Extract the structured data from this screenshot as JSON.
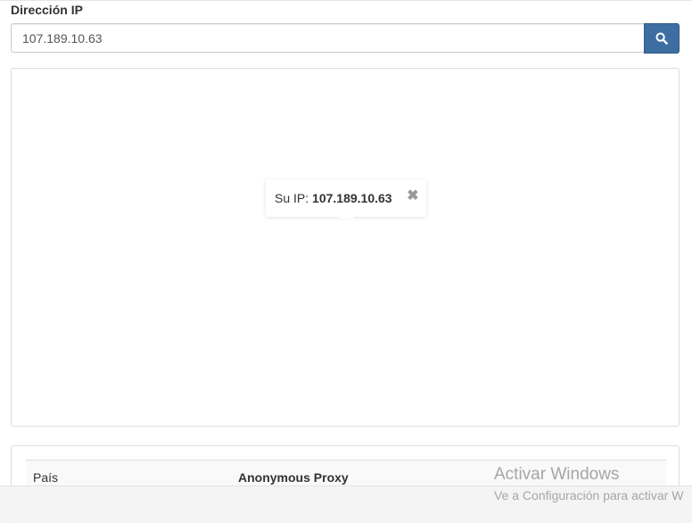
{
  "ip_field": {
    "label": "Dirección IP",
    "value": "107.189.10.63"
  },
  "search_button": {
    "icon": "search-icon"
  },
  "map": {
    "popup": {
      "prefix": "Su IP:",
      "ip": "107.189.10.63",
      "close_glyph": "✖"
    }
  },
  "info_table": {
    "rows": [
      {
        "key": "País",
        "value": "Anonymous Proxy"
      }
    ]
  },
  "windows_watermark": {
    "title": "Activar Windows",
    "subtitle": "Ve a Configuración para activar W"
  },
  "colors": {
    "accent": "#3d6ea1",
    "border": "#dddddd",
    "watermark": "#a6a6a6"
  }
}
